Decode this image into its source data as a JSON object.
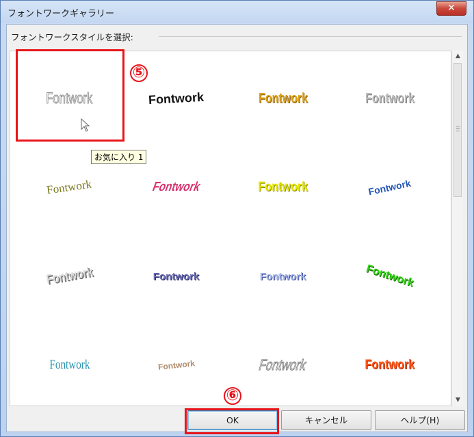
{
  "window": {
    "title": "フォントワークギャラリー",
    "close_symbol": "✕"
  },
  "section_label": "フォントワークスタイルを選択:",
  "gallery": {
    "items": [
      {
        "label": "Fontwork",
        "style": "outline-gray"
      },
      {
        "label": "Fontwork",
        "style": "black-arch"
      },
      {
        "label": "Fontwork",
        "style": "gold"
      },
      {
        "label": "Fontwork",
        "style": "silver"
      },
      {
        "label": "Fontwork",
        "style": "olive-wave"
      },
      {
        "label": "Fontwork",
        "style": "pink-slant"
      },
      {
        "label": "Fontwork",
        "style": "yellow"
      },
      {
        "label": "Fontwork",
        "style": "blue-rise"
      },
      {
        "label": "Fontwork",
        "style": "gray-3d"
      },
      {
        "label": "Fontwork",
        "style": "navy-3d"
      },
      {
        "label": "Fontwork",
        "style": "blue-circle"
      },
      {
        "label": "Fontwork",
        "style": "green-arc"
      },
      {
        "label": "Fontwork",
        "style": "teal"
      },
      {
        "label": "Fontwork",
        "style": "brown-arc"
      },
      {
        "label": "Fontwork",
        "style": "gray-outline-italic"
      },
      {
        "label": "Fontwork",
        "style": "orange-red"
      }
    ]
  },
  "tooltip": "お気に入り 1",
  "annotations": {
    "marker_5": "⑤",
    "marker_6": "⑥"
  },
  "buttons": {
    "ok": "OK",
    "cancel": "キャンセル",
    "help": "ヘルプ(H)"
  },
  "colors": {
    "highlight": "#e8141b",
    "titlebar": "#c9dbf3",
    "close": "#c9483a"
  }
}
